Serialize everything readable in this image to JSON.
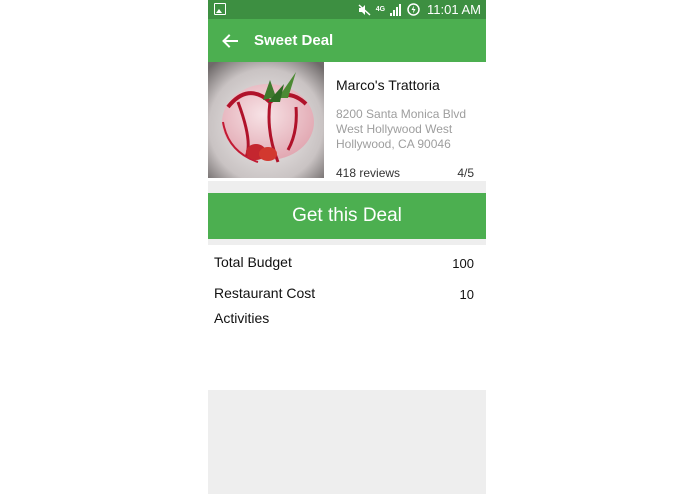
{
  "status_bar": {
    "time": "11:01 AM",
    "network": "4G",
    "icons": [
      "gallery-notification-icon",
      "mute-icon",
      "signal-icon",
      "battery-charging-icon"
    ]
  },
  "toolbar": {
    "title": "Sweet Deal",
    "back_icon": "back-arrow-icon"
  },
  "restaurant": {
    "name": "Marco's Trattoria",
    "address_lines": [
      "8200 Santa Monica Blvd",
      "West Hollywood West",
      "Hollywood, CA 90046"
    ],
    "reviews": "418 reviews",
    "rating": "4/5",
    "image": "dessert-photo"
  },
  "deal_button": "Get this Deal",
  "details": [
    {
      "label": "Total Budget",
      "value": "100"
    },
    {
      "label": "Restaurant Cost",
      "value": "10"
    },
    {
      "label": "Activities",
      "value": ""
    }
  ],
  "colors": {
    "primary": "#4caf50",
    "status_bar": "#3d8f41",
    "divider": "#eeeeee",
    "secondary_text": "#9e9e9e"
  }
}
